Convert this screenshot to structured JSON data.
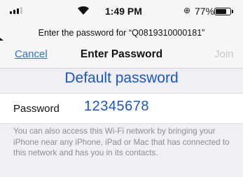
{
  "status_bar": {
    "time": "1:49 PM",
    "battery_percent": "77%",
    "battery_level": 0.77,
    "lock_icon": "⊕",
    "signal_bars_filled": 3,
    "signal_bars_total": 4
  },
  "prompt": "Enter the password for “Q0819310000181”",
  "navbar": {
    "cancel_label": "Cancel",
    "title": "Enter Password",
    "join_label": "Join"
  },
  "annotation": "Default password",
  "password_field": {
    "label": "Password",
    "value": "12345678"
  },
  "info_text": "You can also access this Wi-Fi network by bringing your iPhone near any iPhone, iPad or Mac that has connected to this network and has you in its contacts.",
  "colors": {
    "link": "#2f6fd8",
    "annotation": "#1a56c8",
    "disabled": "#c7c7cc",
    "background": "#efeff4"
  }
}
